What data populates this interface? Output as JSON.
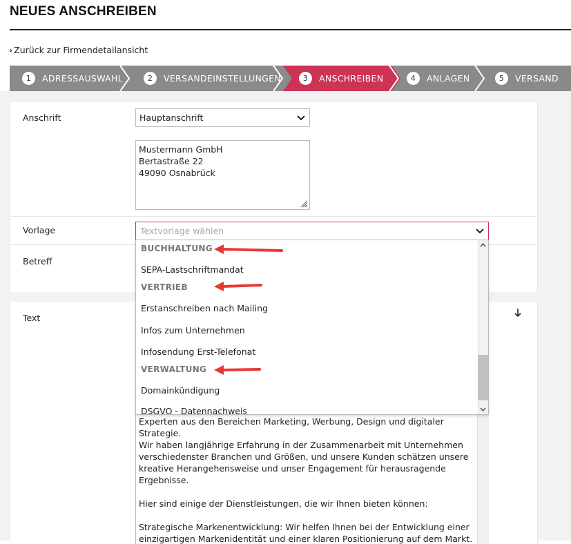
{
  "page": {
    "title": "NEUES ANSCHREIBEN"
  },
  "back_link": {
    "label": "Zurück zur Firmendetailansicht"
  },
  "stepper": {
    "steps": [
      {
        "num": "1",
        "label": "ADRESSAUSWAHL"
      },
      {
        "num": "2",
        "label": "VERSANDEINSTELLUNGEN"
      },
      {
        "num": "3",
        "label": "ANSCHREIBEN"
      },
      {
        "num": "4",
        "label": "ANLAGEN"
      },
      {
        "num": "5",
        "label": "VERSAND"
      }
    ],
    "active_step": 3
  },
  "form": {
    "anschrift": {
      "label": "Anschrift",
      "selected": "Hauptanschrift",
      "address_lines": [
        "Mustermann GmbH",
        "Bertastraße 22",
        "49090 Osnabrück"
      ]
    },
    "vorlage": {
      "label": "Vorlage",
      "placeholder": "Textvorlage wählen"
    },
    "betreff": {
      "label": "Betreff"
    },
    "text": {
      "label": "Text",
      "lines": [
        "Experten aus den Bereichen Marketing, Werbung, Design und digitaler Strategie.",
        "Wir haben langjährige Erfahrung in der Zusammenarbeit mit Unternehmen",
        "verschiedenster Branchen und Größen, und unsere Kunden schätzen unsere",
        "kreative Herangehensweise und unser Engagement für herausragende",
        "Ergebnisse.",
        "",
        "Hier sind einige der Dienstleistungen, die wir Ihnen bieten können:",
        "",
        "Strategische Markenentwicklung: Wir helfen Ihnen bei der Entwicklung einer",
        "einzigartigen Markenidentität und einer klaren Positionierung auf dem Markt."
      ]
    }
  },
  "dropdown": {
    "groups": [
      {
        "name": "BUCHHALTUNG",
        "items": [
          "SEPA-Lastschriftmandat"
        ]
      },
      {
        "name": "VERTRIEB",
        "items": [
          "Erstanschreiben nach Mailing",
          "Infos zum Unternehmen",
          "Infosendung Erst-Telefonat"
        ]
      },
      {
        "name": "VERWALTUNG",
        "items": [
          "Domainkündigung",
          "DSGVO - Datennachweis"
        ]
      }
    ]
  },
  "colors": {
    "accent": "#cc3355",
    "stepper_bg": "#8a8a8a",
    "annotation_arrow": "#e53935"
  },
  "icons": {
    "back": "chevron-right-icon",
    "select": "chevron-down-icon",
    "resize": "resize-grip-icon",
    "scroll_down": "arrow-down-icon",
    "annotation": "red-arrow-icon"
  }
}
